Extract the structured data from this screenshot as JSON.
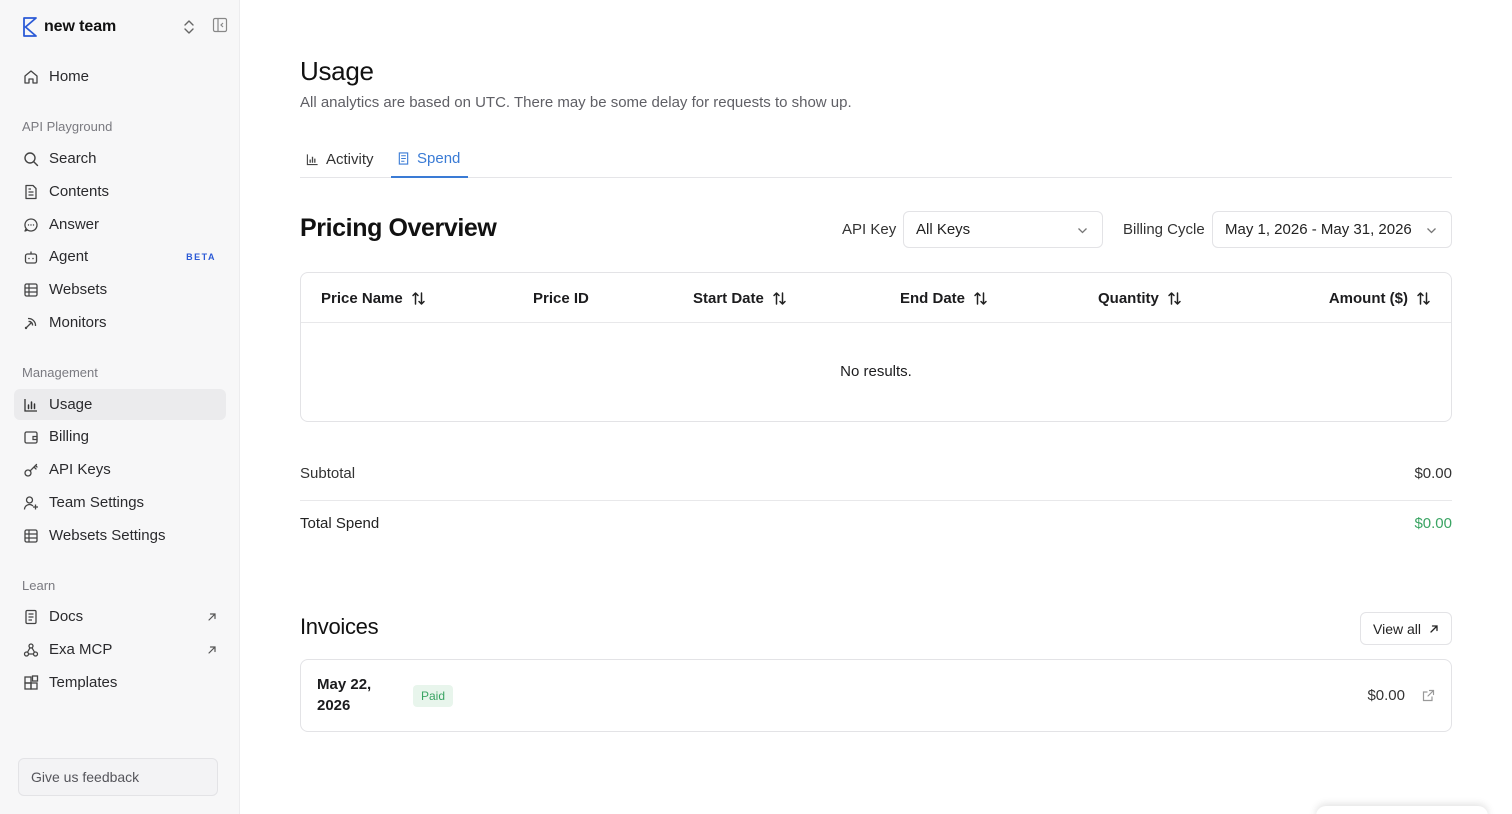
{
  "sidebar": {
    "team_name": "new team",
    "home": "Home",
    "sections": {
      "playground": "API Playground",
      "management": "Management",
      "learn": "Learn"
    },
    "playground_items": [
      "Search",
      "Contents",
      "Answer",
      "Agent",
      "Websets",
      "Monitors"
    ],
    "agent_badge": "BETA",
    "management_items": [
      "Usage",
      "Billing",
      "API Keys",
      "Team Settings",
      "Websets Settings"
    ],
    "learn_items": [
      "Docs",
      "Exa MCP",
      "Templates"
    ],
    "feedback_placeholder": "Give us feedback",
    "active_item": "Usage"
  },
  "header": {
    "title": "Usage",
    "subtitle": "All analytics are based on UTC. There may be some delay for requests to show up."
  },
  "tabs": [
    {
      "label": "Activity",
      "icon": "bar-chart-icon",
      "active": false
    },
    {
      "label": "Spend",
      "icon": "receipt-icon",
      "active": true
    }
  ],
  "pricing": {
    "title": "Pricing Overview",
    "api_key_label": "API Key",
    "api_key_value": "All Keys",
    "billing_cycle_label": "Billing Cycle",
    "billing_cycle_value": "May 1, 2026 - May 31, 2026",
    "columns": [
      "Price Name",
      "Price ID",
      "Start Date",
      "End Date",
      "Quantity",
      "Amount ($)"
    ],
    "empty_text": "No results.",
    "subtotal_label": "Subtotal",
    "subtotal_value": "$0.00",
    "total_label": "Total Spend",
    "total_value": "$0.00",
    "total_color": "#3aa463"
  },
  "invoices": {
    "title": "Invoices",
    "view_all": "View all",
    "items": [
      {
        "date": "May 22, 2026",
        "status": "Paid",
        "amount": "$0.00"
      }
    ]
  },
  "colors": {
    "accent": "#3a7bd5",
    "brand": "#2b5ad6",
    "paid_bg": "#e8f5ec"
  }
}
